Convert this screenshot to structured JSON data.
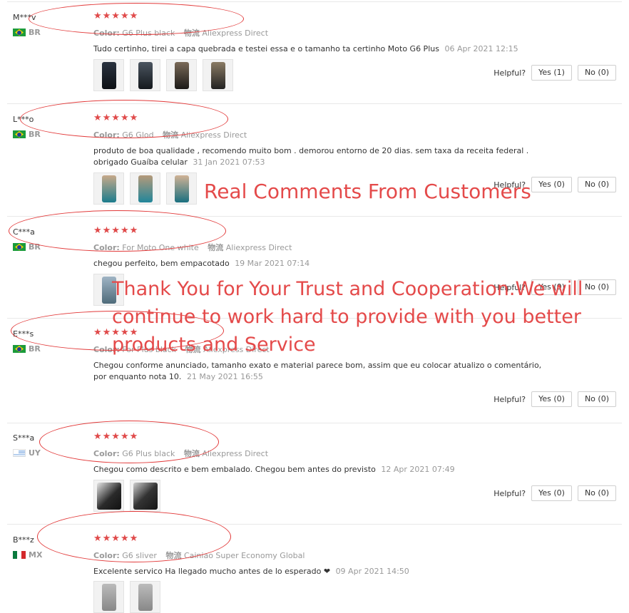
{
  "helpful_label": "Helpful?",
  "reviews": [
    {
      "user": "M***v",
      "country": "BR",
      "stars": "★★★★★",
      "color_label": "Color:",
      "color_value": "G6 Plus black",
      "shipping_label": "物流",
      "shipping_value": "Aliexpress Direct",
      "comment": "Tudo certinho, tirei a capa quebrada e testei essa e o tamanho ta certinho Moto G6 Plus",
      "date": "06 Apr 2021 12:15",
      "yes": "Yes (1)",
      "no": "No (0)"
    },
    {
      "user": "L***o",
      "country": "BR",
      "stars": "★★★★★",
      "color_label": "Color:",
      "color_value": "G6 Glod",
      "shipping_label": "物流",
      "shipping_value": "Aliexpress Direct",
      "comment": "produto de boa qualidade , recomendo muito bom . demorou entorno de 20 dias. sem taxa da receita federal . obrigado Guaíba celular",
      "date": "31 Jan 2021 07:53",
      "yes": "Yes (0)",
      "no": "No (0)"
    },
    {
      "user": "C***a",
      "country": "BR",
      "stars": "★★★★★",
      "color_label": "Color:",
      "color_value": "For Moto One white",
      "shipping_label": "物流",
      "shipping_value": "Aliexpress Direct",
      "comment": "chegou perfeito, bem empacotado",
      "date": "19 Mar 2021 07:14",
      "yes": "Yes (0)",
      "no": "No (0)"
    },
    {
      "user": "E***s",
      "country": "BR",
      "stars": "★★★★★",
      "color_label": "Color:",
      "color_value": "For Plus black",
      "shipping_label": "物流",
      "shipping_value": "Aliexpress Direct",
      "comment": "Chegou conforme anunciado, tamanho exato e material parece bom, assim que eu colocar atualizo o comentário, por enquanto nota 10.",
      "date": "21 May 2021 16:55",
      "yes": "Yes (0)",
      "no": "No (0)"
    },
    {
      "user": "S***a",
      "country": "UY",
      "stars": "★★★★★",
      "color_label": "Color:",
      "color_value": "G6 Plus black",
      "shipping_label": "物流",
      "shipping_value": "Aliexpress Direct",
      "comment": "Chegou como descrito e bem embalado. Chegou bem antes do previsto",
      "date": "12 Apr 2021 07:49",
      "yes": "Yes (0)",
      "no": "No (0)"
    },
    {
      "user": "B***z",
      "country": "MX",
      "stars": "★★★★★",
      "color_label": "Color:",
      "color_value": "G6 sliver",
      "shipping_label": "物流",
      "shipping_value": "Cainiao Super Economy Global",
      "comment": "Excelente servico Ha llegado mucho antes de lo esperado ❤",
      "date": "09 Apr 2021 14:50"
    }
  ],
  "overlay": {
    "line1": "Real Comments From Customers",
    "line2": "Thank  You for Your Trust and Cooperation.We will continue to work hard to provide with you better products and Service"
  },
  "colors": {
    "star": "#e04a4a",
    "annotation": "#e23a3a",
    "overlay_text": "#e44a4a"
  }
}
